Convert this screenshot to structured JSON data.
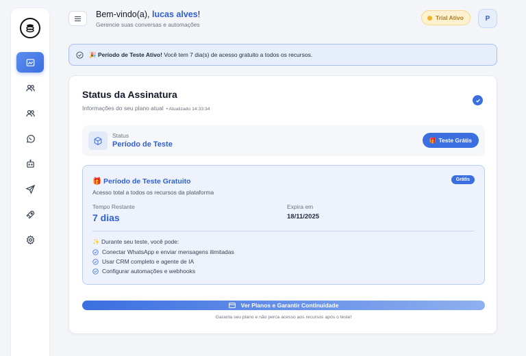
{
  "header": {
    "greeting_prefix": "Bem-vindo(a),",
    "user_name": "lucas alves",
    "greeting_suffix": "!",
    "subtitle": "Gerencie suas conversas e automações",
    "trial_badge": "Trial Ativo",
    "avatar_initial": "P"
  },
  "sidebar": {
    "items": [
      {
        "icon": "chart-icon",
        "active": true
      },
      {
        "icon": "users-icon",
        "active": false
      },
      {
        "icon": "contacts-icon",
        "active": false
      },
      {
        "icon": "whatsapp-icon",
        "active": false
      },
      {
        "icon": "bot-icon",
        "active": false
      },
      {
        "icon": "send-icon",
        "active": false
      },
      {
        "icon": "rocket-icon",
        "active": false
      },
      {
        "icon": "settings-icon",
        "active": false
      }
    ]
  },
  "alert": {
    "emoji": "🎉",
    "bold": "Período de Teste Ativo!",
    "text": "Você tem 7 dia(s) de acesso gratuito a todos os recursos."
  },
  "subscription": {
    "title": "Status da Assinatura",
    "subtitle": "Informações do seu plano atual",
    "updated": "• Atualizado 14:33:34",
    "status_label": "Status",
    "status_value": "Período de Teste",
    "status_pill": "Teste Grátis",
    "trial": {
      "title": "Período de Teste Gratuito",
      "badge": "Grátis",
      "description": "Acesso total a todos os recursos da plataforma",
      "remaining_label": "Tempo Restante",
      "remaining_value": "7 dias",
      "expires_label": "Expira em",
      "expires_value": "18/11/2025",
      "during_label": "Durante seu teste, você pode:",
      "features": [
        "Conectar WhatsApp e enviar mensagens ilimitadas",
        "Usar CRM completo e agente de IA",
        "Configurar automações e webhooks"
      ]
    },
    "cta_label": "Ver Planos e Garantir Continuidade",
    "cta_note": "Garanta seu plano e não perca acesso aos recursos após o teste!"
  },
  "colors": {
    "accent": "#3b6fe0",
    "accent_text": "#2f5fd0",
    "trial_badge_bg": "#fdf1cf",
    "trial_badge_text": "#b7791f"
  }
}
